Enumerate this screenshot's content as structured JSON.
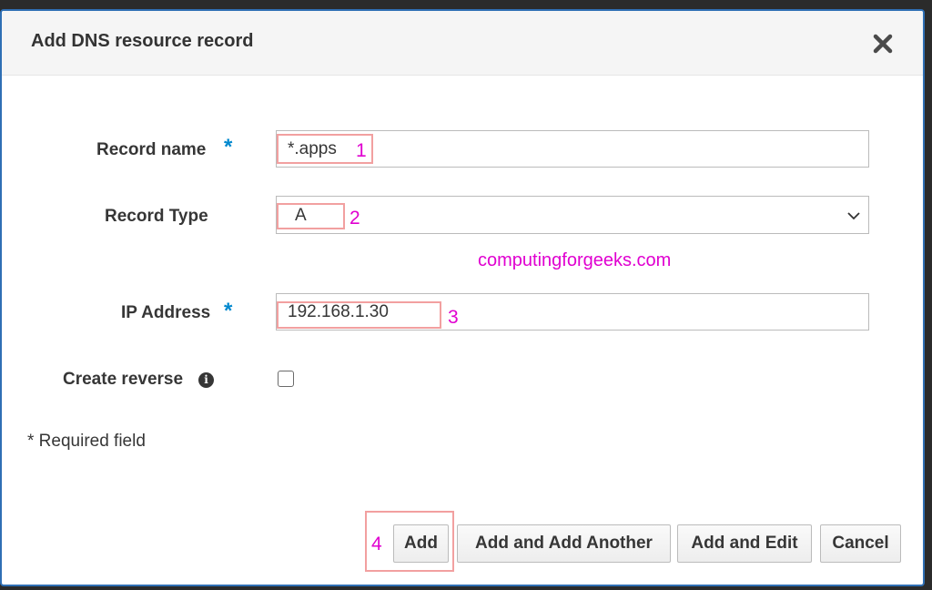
{
  "dialog": {
    "title": "Add DNS resource record",
    "close_icon": "close-x-icon"
  },
  "form": {
    "record_name": {
      "label": "Record name",
      "required_mark": "*",
      "value": "*.apps"
    },
    "record_type": {
      "label": "Record Type",
      "value": "A"
    },
    "ip_address": {
      "label": "IP Address",
      "required_mark": "*",
      "value": "192.168.1.30"
    },
    "create_reverse": {
      "label": "Create reverse",
      "info_icon": "i",
      "checked": false
    },
    "required_note": "* Required field"
  },
  "annotations": {
    "n1": "1",
    "n2": "2",
    "n3": "3",
    "n4": "4",
    "color": "#e000d0"
  },
  "watermark": "computingforgeeks.com",
  "buttons": {
    "add": "Add",
    "add_another": "Add and Add Another",
    "add_edit": "Add and Edit",
    "cancel": "Cancel"
  },
  "colors": {
    "accent": "#0088ce",
    "border": "#2f6fb4"
  }
}
